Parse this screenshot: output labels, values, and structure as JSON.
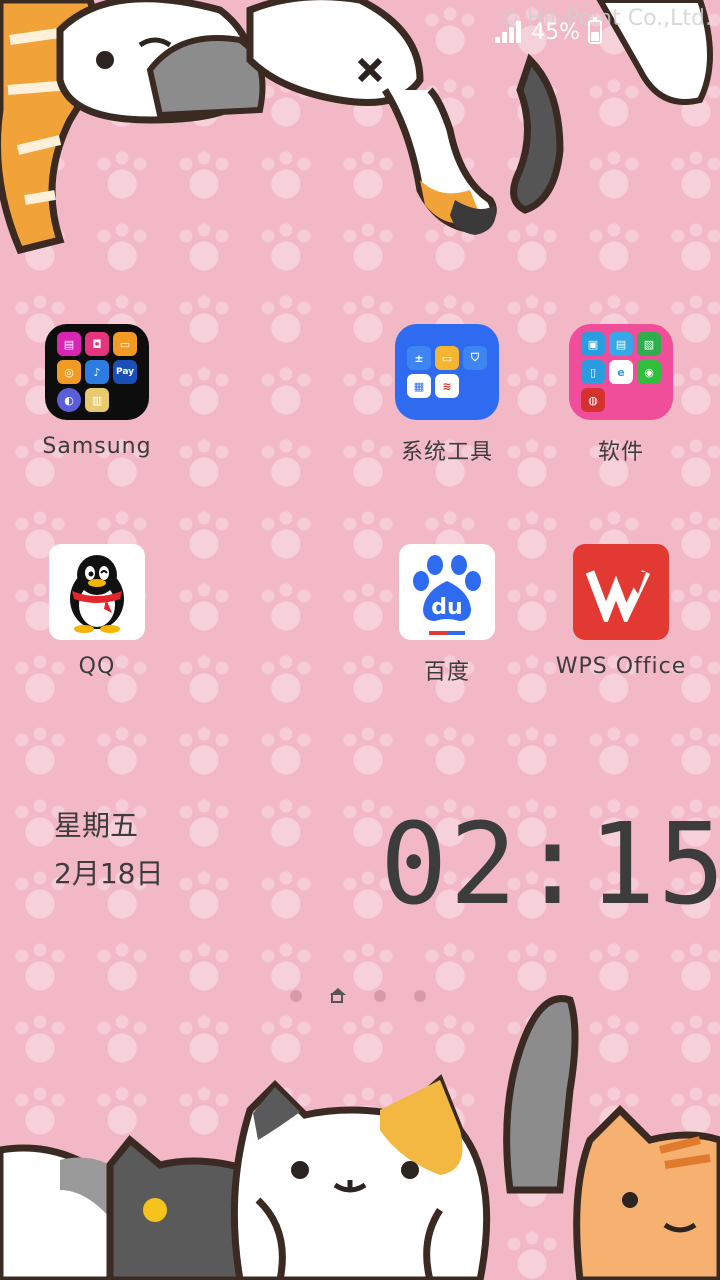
{
  "status_bar": {
    "watermark": "© Hit-Point Co.,Ltd.",
    "battery_text": "45%",
    "battery_level": 0.45,
    "signal_icon": "signal-icon",
    "battery_icon": "battery-icon"
  },
  "apps": [
    {
      "label": "Samsung",
      "type": "folder"
    },
    {
      "label": "系统工具",
      "type": "folder"
    },
    {
      "label": "软件",
      "type": "folder"
    },
    {
      "label": "QQ",
      "type": "app"
    },
    {
      "label": "百度",
      "type": "app"
    },
    {
      "label": "WPS Office",
      "type": "app"
    }
  ],
  "samsung_folder": {
    "pay_label": "Pay"
  },
  "baidu_icon_text": "du",
  "widget": {
    "weekday": "星期五",
    "date": "2月18日",
    "time": "02:15"
  },
  "colors": {
    "background": "#f2b8c6",
    "text": "#3c3c3c",
    "wps_red": "#e23a33",
    "baidu_blue": "#2f6bf0"
  },
  "page_indicator": {
    "pages": 4,
    "current": 1
  }
}
